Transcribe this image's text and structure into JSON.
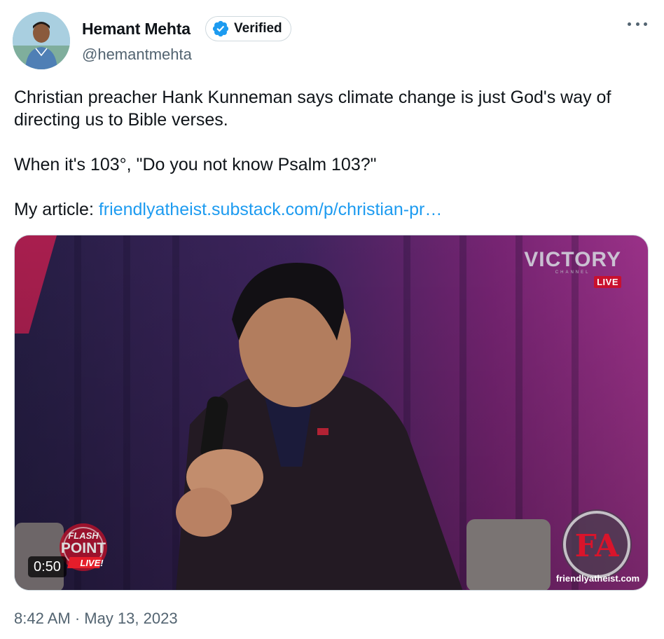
{
  "author": {
    "display_name": "Hemant Mehta",
    "verified_label": "Verified",
    "handle": "@hemantmehta",
    "avatar_icon": "profile-photo",
    "verified_icon": "verified-badge-icon"
  },
  "menu": {
    "icon": "more-horizontal-icon"
  },
  "tweet": {
    "line1": "Christian preacher Hank Kunneman says climate change is just God's way of directing us to Bible verses.",
    "line2": "When it's 103°, \"Do you not know Psalm 103?\"",
    "article_prefix": "My article: ",
    "article_link": "friendlyatheist.substack.com/p/christian-pr…"
  },
  "media": {
    "type": "video",
    "duration": "0:50",
    "channel_logo": "VICTORY",
    "channel_sub": "CHANNEL",
    "live_tag": "LIVE",
    "show_logo_top": "FLASH",
    "show_logo_mid": "POINT",
    "show_logo_bottom": "LIVE!",
    "watermark_text": "friendlyatheist.com",
    "watermark_mark": "FA"
  },
  "timestamp": "8:42 AM · May 13, 2023",
  "colors": {
    "link": "#1d9bf0",
    "verified": "#1d9bf0",
    "secondary_text": "#536471"
  }
}
